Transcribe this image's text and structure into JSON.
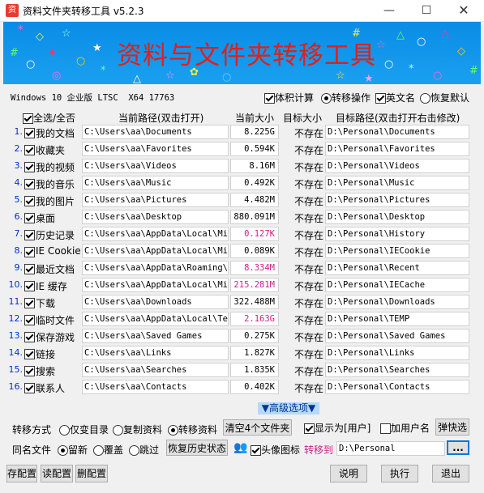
{
  "window": {
    "title": "资料文件夹转移工具 v5.2.3"
  },
  "banner": {
    "title": "资料与文件夹转移工具"
  },
  "info": {
    "os": "Windows 10",
    "edition": "企业版",
    "ltsc": "LTSC",
    "arch": "X64 17763"
  },
  "options_top": {
    "size_calc": "体积计算",
    "transfer_op": "转移操作",
    "english_name": "英文名",
    "restore_default": "恢复默认"
  },
  "headers": {
    "select_all": "全选/全否",
    "current_path": "当前路径(双击打开)",
    "current_size": "当前大小",
    "target_size": "目标大小",
    "target_path": "目标路径(双击打开右击修改)"
  },
  "rows": [
    {
      "n": "1.",
      "label": "我的文档",
      "path": "C:\\Users\\aa\\Documents",
      "size": "8.225G",
      "size_color": "#000000",
      "status": "不存在",
      "target": "D:\\Personal\\Documents"
    },
    {
      "n": "2.",
      "label": "收藏夹",
      "path": "C:\\Users\\aa\\Favorites",
      "size": "0.594K",
      "size_color": "#000000",
      "status": "不存在",
      "target": "D:\\Personal\\Favorites"
    },
    {
      "n": "3.",
      "label": "我的视频",
      "path": "C:\\Users\\aa\\Videos",
      "size": "8.16M",
      "size_color": "#000000",
      "status": "不存在",
      "target": "D:\\Personal\\Videos"
    },
    {
      "n": "4.",
      "label": "我的音乐",
      "path": "C:\\Users\\aa\\Music",
      "size": "0.492K",
      "size_color": "#000000",
      "status": "不存在",
      "target": "D:\\Personal\\Music"
    },
    {
      "n": "5.",
      "label": "我的图片",
      "path": "C:\\Users\\aa\\Pictures",
      "size": "4.482M",
      "size_color": "#000000",
      "status": "不存在",
      "target": "D:\\Personal\\Pictures"
    },
    {
      "n": "6.",
      "label": "桌面",
      "path": "C:\\Users\\aa\\Desktop",
      "size": "880.091M",
      "size_color": "#000000",
      "status": "不存在",
      "target": "D:\\Personal\\Desktop"
    },
    {
      "n": "7.",
      "label": "历史记录",
      "path": "C:\\Users\\aa\\AppData\\Local\\Micr",
      "size": "0.127K",
      "size_color": "#d0208a",
      "status": "不存在",
      "target": "D:\\Personal\\History"
    },
    {
      "n": "8.",
      "label": "IE Cookie",
      "path": "C:\\Users\\aa\\AppData\\Local\\Micr",
      "size": "0.089K",
      "size_color": "#000000",
      "status": "不存在",
      "target": "D:\\Personal\\IECookie"
    },
    {
      "n": "9.",
      "label": "最近文档",
      "path": "C:\\Users\\aa\\AppData\\Roaming\\Mi",
      "size": "8.334M",
      "size_color": "#d0208a",
      "status": "不存在",
      "target": "D:\\Personal\\Recent"
    },
    {
      "n": "10.",
      "label": "IE 缓存",
      "path": "C:\\Users\\aa\\AppData\\Local\\Micr",
      "size": "215.281M",
      "size_color": "#d0208a",
      "status": "不存在",
      "target": "D:\\Personal\\IECache"
    },
    {
      "n": "11.",
      "label": "下载",
      "path": "C:\\Users\\aa\\Downloads",
      "size": "322.488M",
      "size_color": "#000000",
      "status": "不存在",
      "target": "D:\\Personal\\Downloads"
    },
    {
      "n": "12.",
      "label": "临时文件",
      "path": "C:\\Users\\aa\\AppData\\Local\\Temp",
      "size": "2.163G",
      "size_color": "#d0208a",
      "status": "不存在",
      "target": "D:\\Personal\\TEMP"
    },
    {
      "n": "13.",
      "label": "保存游戏",
      "path": "C:\\Users\\aa\\Saved Games",
      "size": "0.275K",
      "size_color": "#000000",
      "status": "不存在",
      "target": "D:\\Personal\\Saved Games"
    },
    {
      "n": "14.",
      "label": "链接",
      "path": "C:\\Users\\aa\\Links",
      "size": "1.827K",
      "size_color": "#000000",
      "status": "不存在",
      "target": "D:\\Personal\\Links"
    },
    {
      "n": "15.",
      "label": "搜索",
      "path": "C:\\Users\\aa\\Searches",
      "size": "1.835K",
      "size_color": "#000000",
      "status": "不存在",
      "target": "D:\\Personal\\Searches"
    },
    {
      "n": "16.",
      "label": "联系人",
      "path": "C:\\Users\\aa\\Contacts",
      "size": "0.402K",
      "size_color": "#000000",
      "status": "不存在",
      "target": "D:\\Personal\\Contacts"
    }
  ],
  "advanced": {
    "label": "高级选项"
  },
  "transfer_mode": {
    "label": "转移方式",
    "opt1": "仅变目录",
    "opt2": "复制资料",
    "opt3": "转移资料",
    "clear_btn": "清空4个文件夹",
    "show_user": "显示为[用户]",
    "add_user": "加用户名",
    "popup_btn": "弹快选"
  },
  "same_name": {
    "label": "同名文件",
    "opt1": "留新",
    "opt2": "覆盖",
    "opt3": "跳过",
    "restore_btn": "恢复历史状态",
    "avatar_icon": "头像图标",
    "transfer_to": "转移到",
    "target_dir": "D:\\Personal",
    "browse": "..."
  },
  "bottom": {
    "save_cfg": "存配置",
    "read_cfg": "读配置",
    "del_cfg": "删配置",
    "help": "说明",
    "run": "执行",
    "exit": "退出"
  },
  "colors": {
    "banner": "#0a8ce6",
    "banner_title": "#e0201a",
    "highlight_size": "#d0208a",
    "num": "#0033cc",
    "advanced_bg": "#b7d9f8",
    "transfer_to": "#d0208a"
  }
}
